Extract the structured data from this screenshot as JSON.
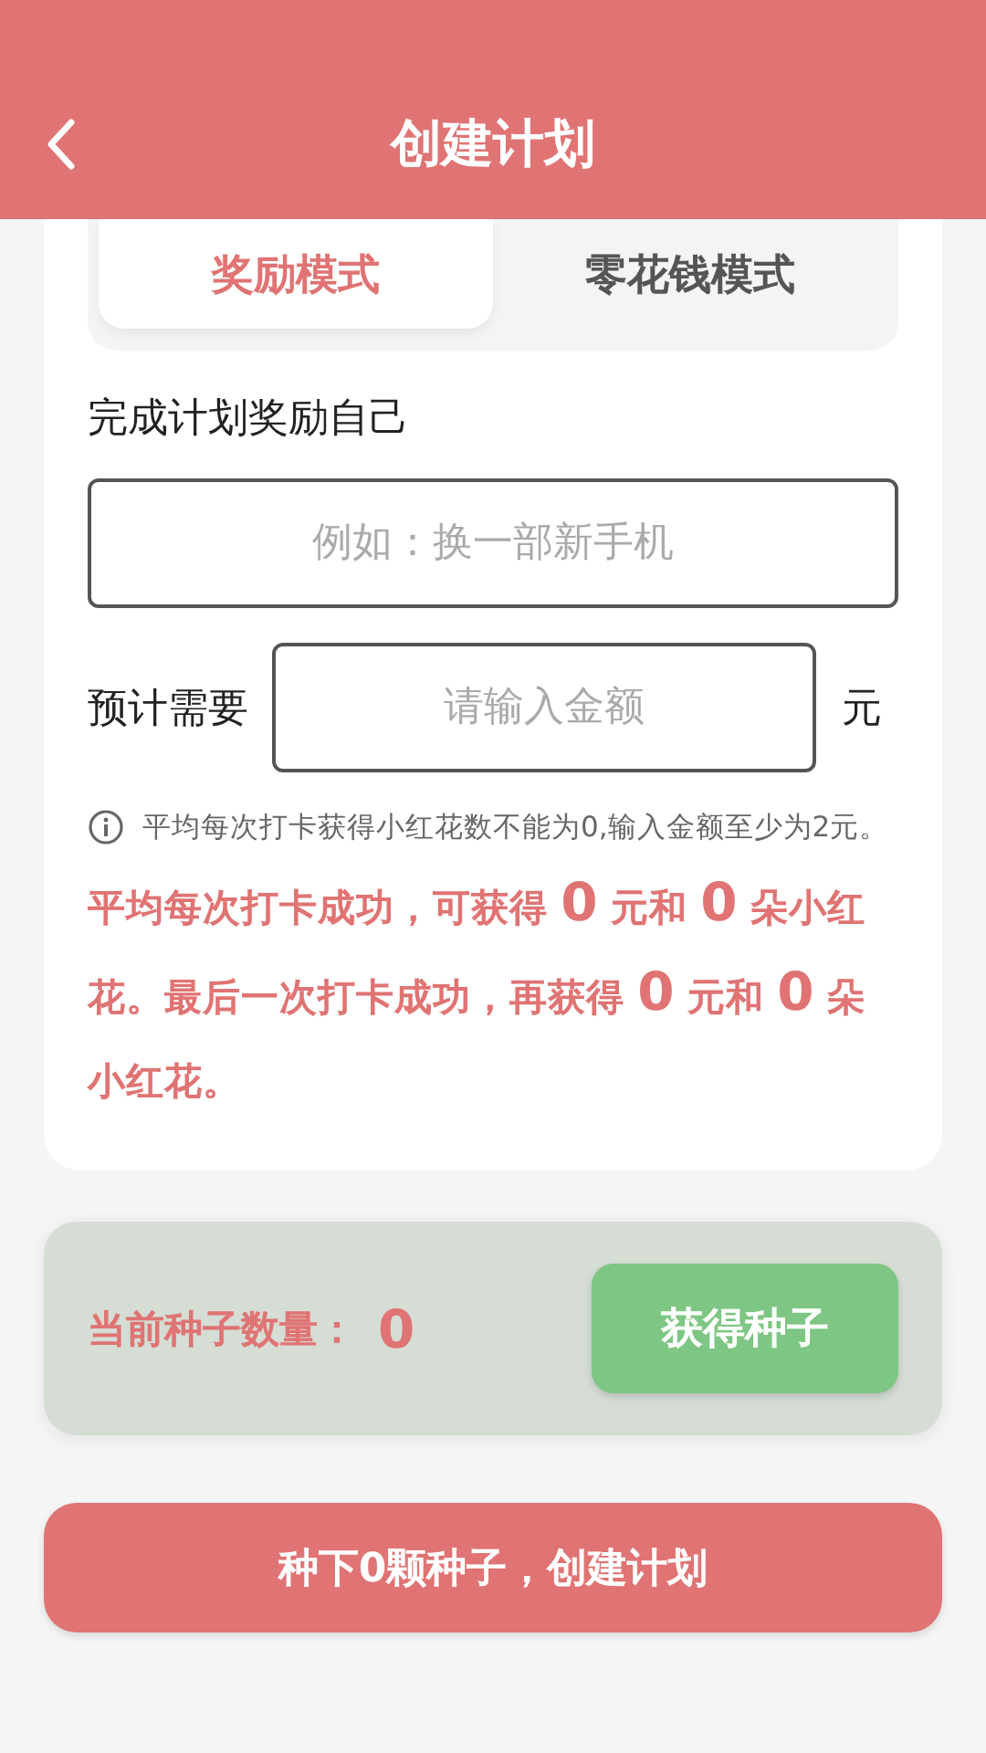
{
  "header": {
    "title": "创建计划"
  },
  "tabs": [
    {
      "label": "奖励模式",
      "selected": true
    },
    {
      "label": "零花钱模式",
      "selected": false
    }
  ],
  "reward": {
    "label": "完成计划奖励自己",
    "placeholder": "例如：换一部新手机"
  },
  "amount": {
    "label": "预计需要",
    "placeholder": "请输入金额",
    "unit": "元"
  },
  "notice": "平均每次打卡获得小红花数不能为0,输入金额至少为2元。",
  "summary": [
    {
      "kind": "text",
      "text": "平均每次打卡成功，可获得 "
    },
    {
      "kind": "number",
      "text": "0"
    },
    {
      "kind": "text",
      "text": " 元和 "
    },
    {
      "kind": "number",
      "text": "0"
    },
    {
      "kind": "text",
      "text": " 朵小红花。最后一次打卡成功，再获得 "
    },
    {
      "kind": "number",
      "text": "0"
    },
    {
      "kind": "text",
      "text": " 元和 "
    },
    {
      "kind": "number",
      "text": "0"
    },
    {
      "kind": "text",
      "text": " 朵小红花。"
    }
  ],
  "seeds": {
    "label": "当前种子数量：",
    "count": "0",
    "button": "获得种子"
  },
  "submit": "种下0颗种子，创建计划"
}
